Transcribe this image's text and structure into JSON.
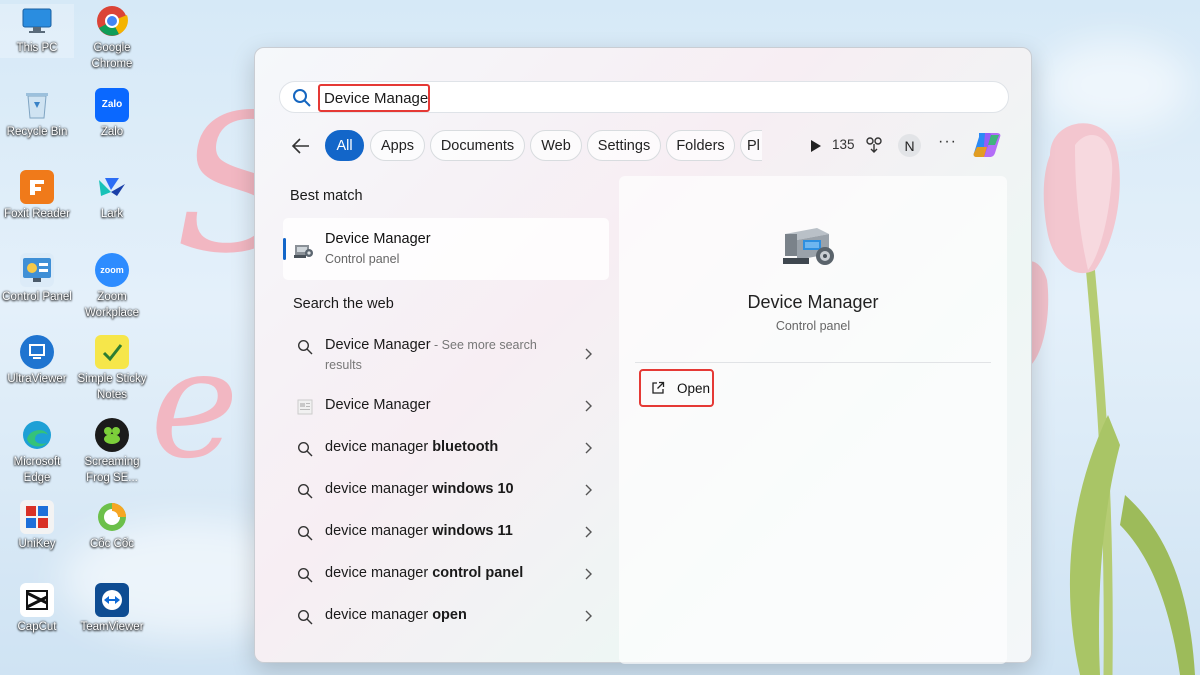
{
  "desktop": {
    "icons": [
      {
        "label": "This PC"
      },
      {
        "label": "Google Chrome"
      },
      {
        "label": "Recycle Bin"
      },
      {
        "label": "Zalo",
        "glyph": "Zalo"
      },
      {
        "label": "Foxit Reader"
      },
      {
        "label": "Lark"
      },
      {
        "label": "Control Panel"
      },
      {
        "label": "Zoom Workplace",
        "glyph": "zoom"
      },
      {
        "label": "UltraViewer"
      },
      {
        "label": "Simple Sticky Notes"
      },
      {
        "label": "Microsoft Edge"
      },
      {
        "label": "Screaming Frog SE..."
      },
      {
        "label": "UniKey"
      },
      {
        "label": "Cốc Cốc"
      },
      {
        "label": "CapCut"
      },
      {
        "label": "TeamViewer"
      }
    ]
  },
  "search": {
    "query": "Device Manager",
    "filters": [
      "All",
      "Apps",
      "Documents",
      "Web",
      "Settings",
      "Folders",
      "Pl"
    ],
    "active_filter": "All",
    "count": "135",
    "avatar_letter": "N",
    "more": "···"
  },
  "best_match": {
    "heading": "Best match",
    "title": "Device Manager",
    "subtitle": "Control panel"
  },
  "web": {
    "heading": "Search the web",
    "items": [
      {
        "prefix": "Device Manager",
        "bold": "",
        "sub": " - See more search",
        "sub2": "results"
      },
      {
        "prefix": "Device Manager",
        "bold": ""
      },
      {
        "prefix": "device manager ",
        "bold": "bluetooth"
      },
      {
        "prefix": "device manager ",
        "bold": "windows 10"
      },
      {
        "prefix": "device manager ",
        "bold": "windows 11"
      },
      {
        "prefix": "device manager ",
        "bold": "control panel"
      },
      {
        "prefix": "device manager ",
        "bold": "open"
      }
    ]
  },
  "preview": {
    "title": "Device Manager",
    "subtitle": "Control panel",
    "open_label": "Open"
  },
  "colors": {
    "accent": "#1366c9",
    "highlight_border": "#e53935"
  }
}
